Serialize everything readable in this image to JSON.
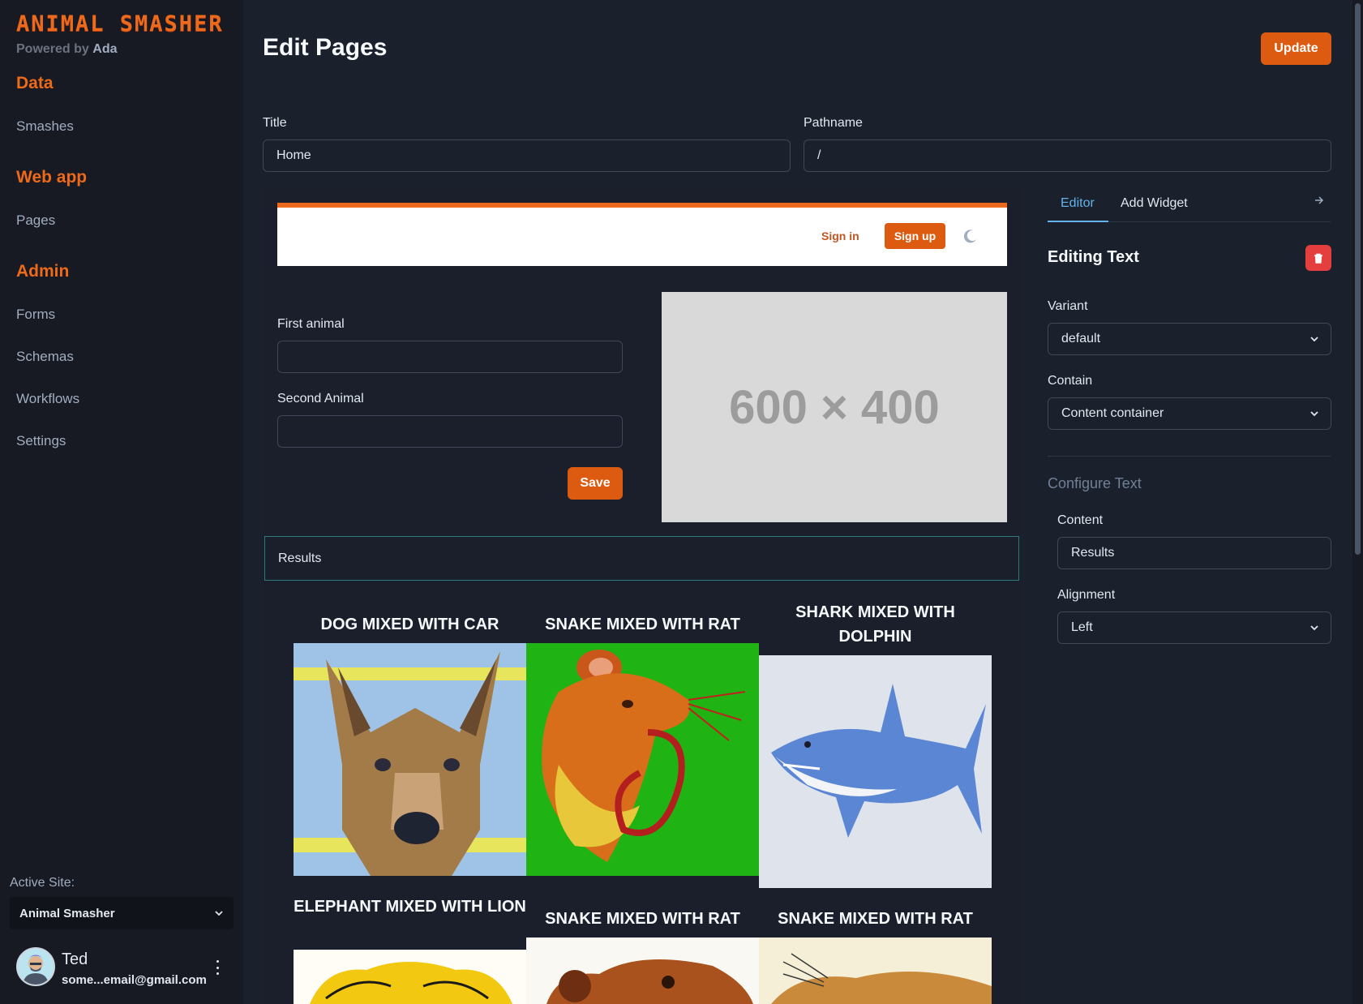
{
  "brand": {
    "name": "ANIMAL SMASHER",
    "powered_prefix": "Powered by",
    "powered_name": "Ada"
  },
  "sidebar": {
    "sections": [
      {
        "title": "Data",
        "items": [
          "Smashes"
        ]
      },
      {
        "title": "Web app",
        "items": [
          "Pages"
        ]
      },
      {
        "title": "Admin",
        "items": [
          "Forms",
          "Schemas",
          "Workflows",
          "Settings"
        ]
      }
    ],
    "active_site_label": "Active Site:",
    "active_site_value": "Animal Smasher",
    "user": {
      "name": "Ted",
      "email": "some...email@gmail.com"
    }
  },
  "header": {
    "title": "Edit Pages",
    "update_label": "Update"
  },
  "page_fields": {
    "title_label": "Title",
    "title_value": "Home",
    "pathname_label": "Pathname",
    "pathname_value": "/"
  },
  "preview": {
    "signin": "Sign in",
    "signup": "Sign up",
    "first_animal_label": "First animal",
    "second_animal_label": "Second Animal",
    "save_label": "Save",
    "placeholder_text": "600 × 400",
    "results_text": "Results",
    "cards": [
      {
        "title": "DOG MIXED WITH CAR"
      },
      {
        "title": "SNAKE MIXED WITH RAT"
      },
      {
        "title": "SHARK MIXED WITH DOLPHIN"
      },
      {
        "title": "ELEPHANT MIXED WITH LION"
      },
      {
        "title": "SNAKE MIXED WITH RAT"
      },
      {
        "title": "SNAKE MIXED WITH RAT"
      }
    ]
  },
  "panel": {
    "tab_editor": "Editor",
    "tab_add_widget": "Add Widget",
    "editing_title": "Editing Text",
    "variant_label": "Variant",
    "variant_value": "default",
    "contain_label": "Contain",
    "contain_value": "Content container",
    "configure_label": "Configure Text",
    "content_label": "Content",
    "content_value": "Results",
    "alignment_label": "Alignment",
    "alignment_value": "Left"
  },
  "colors": {
    "accent": "#dd5b10",
    "brand": "#ec6a1c",
    "tab_active": "#63b3ed",
    "danger": "#e53e3e"
  }
}
